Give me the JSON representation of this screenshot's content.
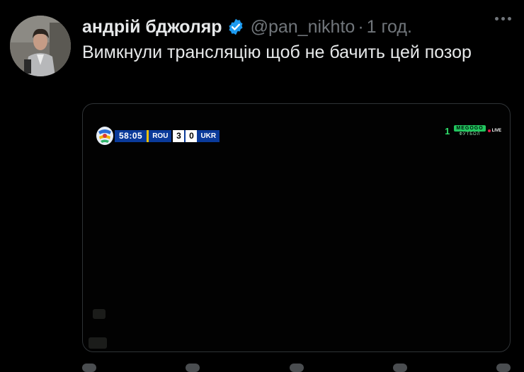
{
  "tweet": {
    "display_name": "андрій бджоляр",
    "handle": "@pan_nikhto",
    "separator": "·",
    "time": "1 год.",
    "text": "Вимкнули трансляцію щоб не бачить цей позор",
    "verified": true
  },
  "media": {
    "scorebug": {
      "clock": "58:05",
      "home_team": "ROU",
      "home_score": "3",
      "away_score": "0",
      "away_team": "UKR"
    },
    "broadcaster": {
      "channel": "1",
      "brand": "MEGOGO",
      "sub": "ФУТБОЛ",
      "live": "LIVE"
    }
  },
  "colors": {
    "background": "#000000",
    "verified_blue": "#1d9bf0",
    "secondary_text": "#71767b",
    "scorebug_blue": "#0a3a9a",
    "megogo_green": "#22c55e"
  },
  "icons": {
    "verified": "verified-badge-icon",
    "more": "more-options-icon",
    "euro_logo": "euro-tournament-logo"
  }
}
